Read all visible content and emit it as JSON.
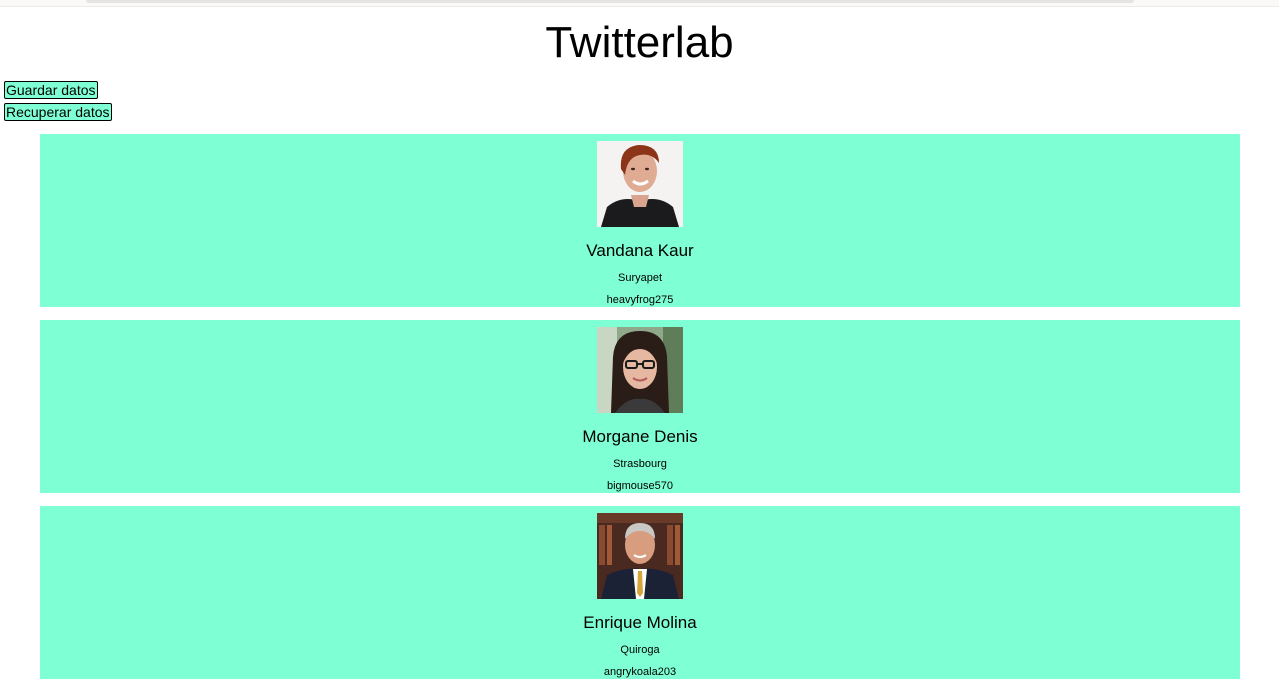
{
  "app": {
    "title": "Twitterlab"
  },
  "actions": {
    "save_label": "Guardar datos",
    "load_label": "Recuperar datos"
  },
  "colors": {
    "card_background": "#7fffd4",
    "page_background": "#ffffff"
  },
  "users": [
    {
      "name": "Vandana Kaur",
      "city": "Suryapet",
      "username": "heavyfrog275",
      "avatar": "woman-red-hair-photo"
    },
    {
      "name": "Morgane Denis",
      "city": "Strasbourg",
      "username": "bigmouse570",
      "avatar": "woman-glasses-photo"
    },
    {
      "name": "Enrique Molina",
      "city": "Quiroga",
      "username": "angrykoala203",
      "avatar": "man-suit-photo"
    }
  ]
}
